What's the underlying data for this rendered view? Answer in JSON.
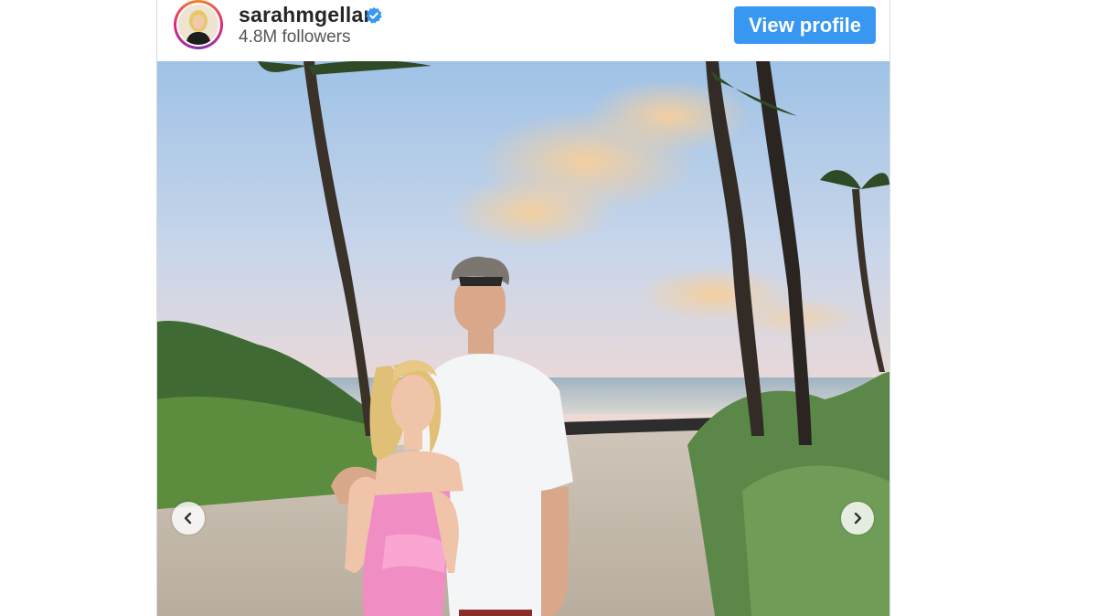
{
  "profile": {
    "username": "sarahmgellar",
    "followers": "4.8M followers",
    "verified": true,
    "avatar_icon": "profile-avatar"
  },
  "actions": {
    "view_profile_label": "View profile"
  },
  "carousel": {
    "prev_icon": "chevron-left-icon",
    "next_icon": "chevron-right-icon"
  },
  "colors": {
    "button": "#3897f0",
    "verified_badge": "#3897f0",
    "username": "#262626"
  }
}
